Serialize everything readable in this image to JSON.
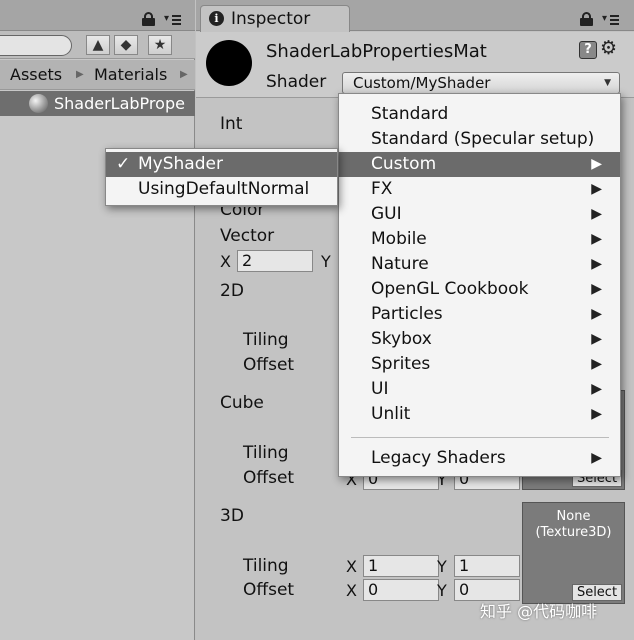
{
  "project_panel": {
    "breadcrumb": [
      "Assets",
      "Materials"
    ],
    "asset_item": "ShaderLabPrope"
  },
  "inspector": {
    "tab_label": "Inspector",
    "material_name": "ShaderLabPropertiesMat",
    "shader_label": "Shader",
    "shader_value": "Custom/MyShader",
    "properties": {
      "int_label": "Int",
      "color_label": "Color",
      "vector_label": "Vector",
      "vector_x_label": "X",
      "vector_x_value": "2",
      "vector_y_label": "Y",
      "tex2d_label": "2D",
      "tiling_label": "Tiling",
      "offset_label": "Offset",
      "cube_label": "Cube",
      "tex3d_label": "3D",
      "tex3d_tiling_x": "1",
      "tex3d_tiling_y": "1",
      "tex3d_offset_x": "0",
      "tex3d_offset_y": "0",
      "cube_offset_x": "0",
      "cube_offset_y": "0",
      "x_label": "X",
      "y_label": "Y",
      "texture3d_slot": "None\n(Texture3D)",
      "select_label": "Select"
    }
  },
  "shader_menu": {
    "items": [
      {
        "label": "Standard",
        "submenu": false
      },
      {
        "label": "Standard (Specular setup)",
        "submenu": false
      },
      {
        "label": "Custom",
        "submenu": true
      },
      {
        "label": "FX",
        "submenu": true
      },
      {
        "label": "GUI",
        "submenu": true
      },
      {
        "label": "Mobile",
        "submenu": true
      },
      {
        "label": "Nature",
        "submenu": true
      },
      {
        "label": "OpenGL Cookbook",
        "submenu": true
      },
      {
        "label": "Particles",
        "submenu": true
      },
      {
        "label": "Skybox",
        "submenu": true
      },
      {
        "label": "Sprites",
        "submenu": true
      },
      {
        "label": "UI",
        "submenu": true
      },
      {
        "label": "Unlit",
        "submenu": true
      }
    ],
    "legacy": {
      "label": "Legacy Shaders",
      "submenu": true
    },
    "highlighted": "Custom"
  },
  "custom_submenu": {
    "items": [
      {
        "label": "MyShader",
        "checked": true
      },
      {
        "label": "UsingDefaultNormal",
        "checked": false
      }
    ],
    "check_glyph": "✓"
  },
  "watermark": "知乎 @代码咖啡"
}
